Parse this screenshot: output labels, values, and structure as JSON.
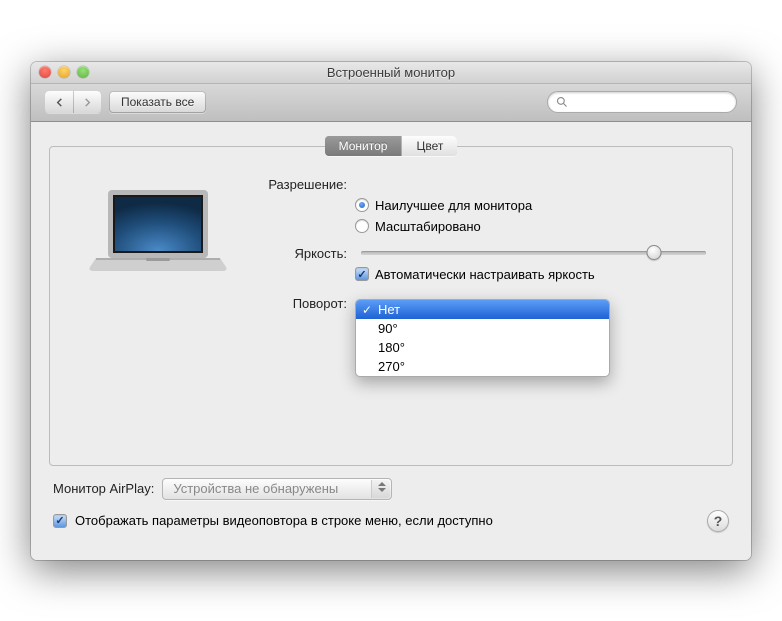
{
  "window": {
    "title": "Встроенный монитор"
  },
  "toolbar": {
    "show_all": "Показать все",
    "search_placeholder": ""
  },
  "tabs": [
    {
      "label": "Монитор",
      "active": true
    },
    {
      "label": "Цвет",
      "active": false
    }
  ],
  "settings": {
    "resolution_label": "Разрешение:",
    "resolution_options": {
      "best": "Наилучшее для монитора",
      "scaled": "Масштабировано"
    },
    "brightness_label": "Яркость:",
    "brightness_value_pct": 85,
    "auto_brightness": "Автоматически настраивать яркость",
    "rotation_label": "Поворот:",
    "rotation_options": [
      "Нет",
      "90°",
      "180°",
      "270°"
    ],
    "rotation_selected": "Нет"
  },
  "footer": {
    "airplay_label": "Монитор AirPlay:",
    "airplay_value": "Устройства не обнаружены",
    "show_mirroring": "Отображать параметры видеоповтора в строке меню, если доступно"
  }
}
